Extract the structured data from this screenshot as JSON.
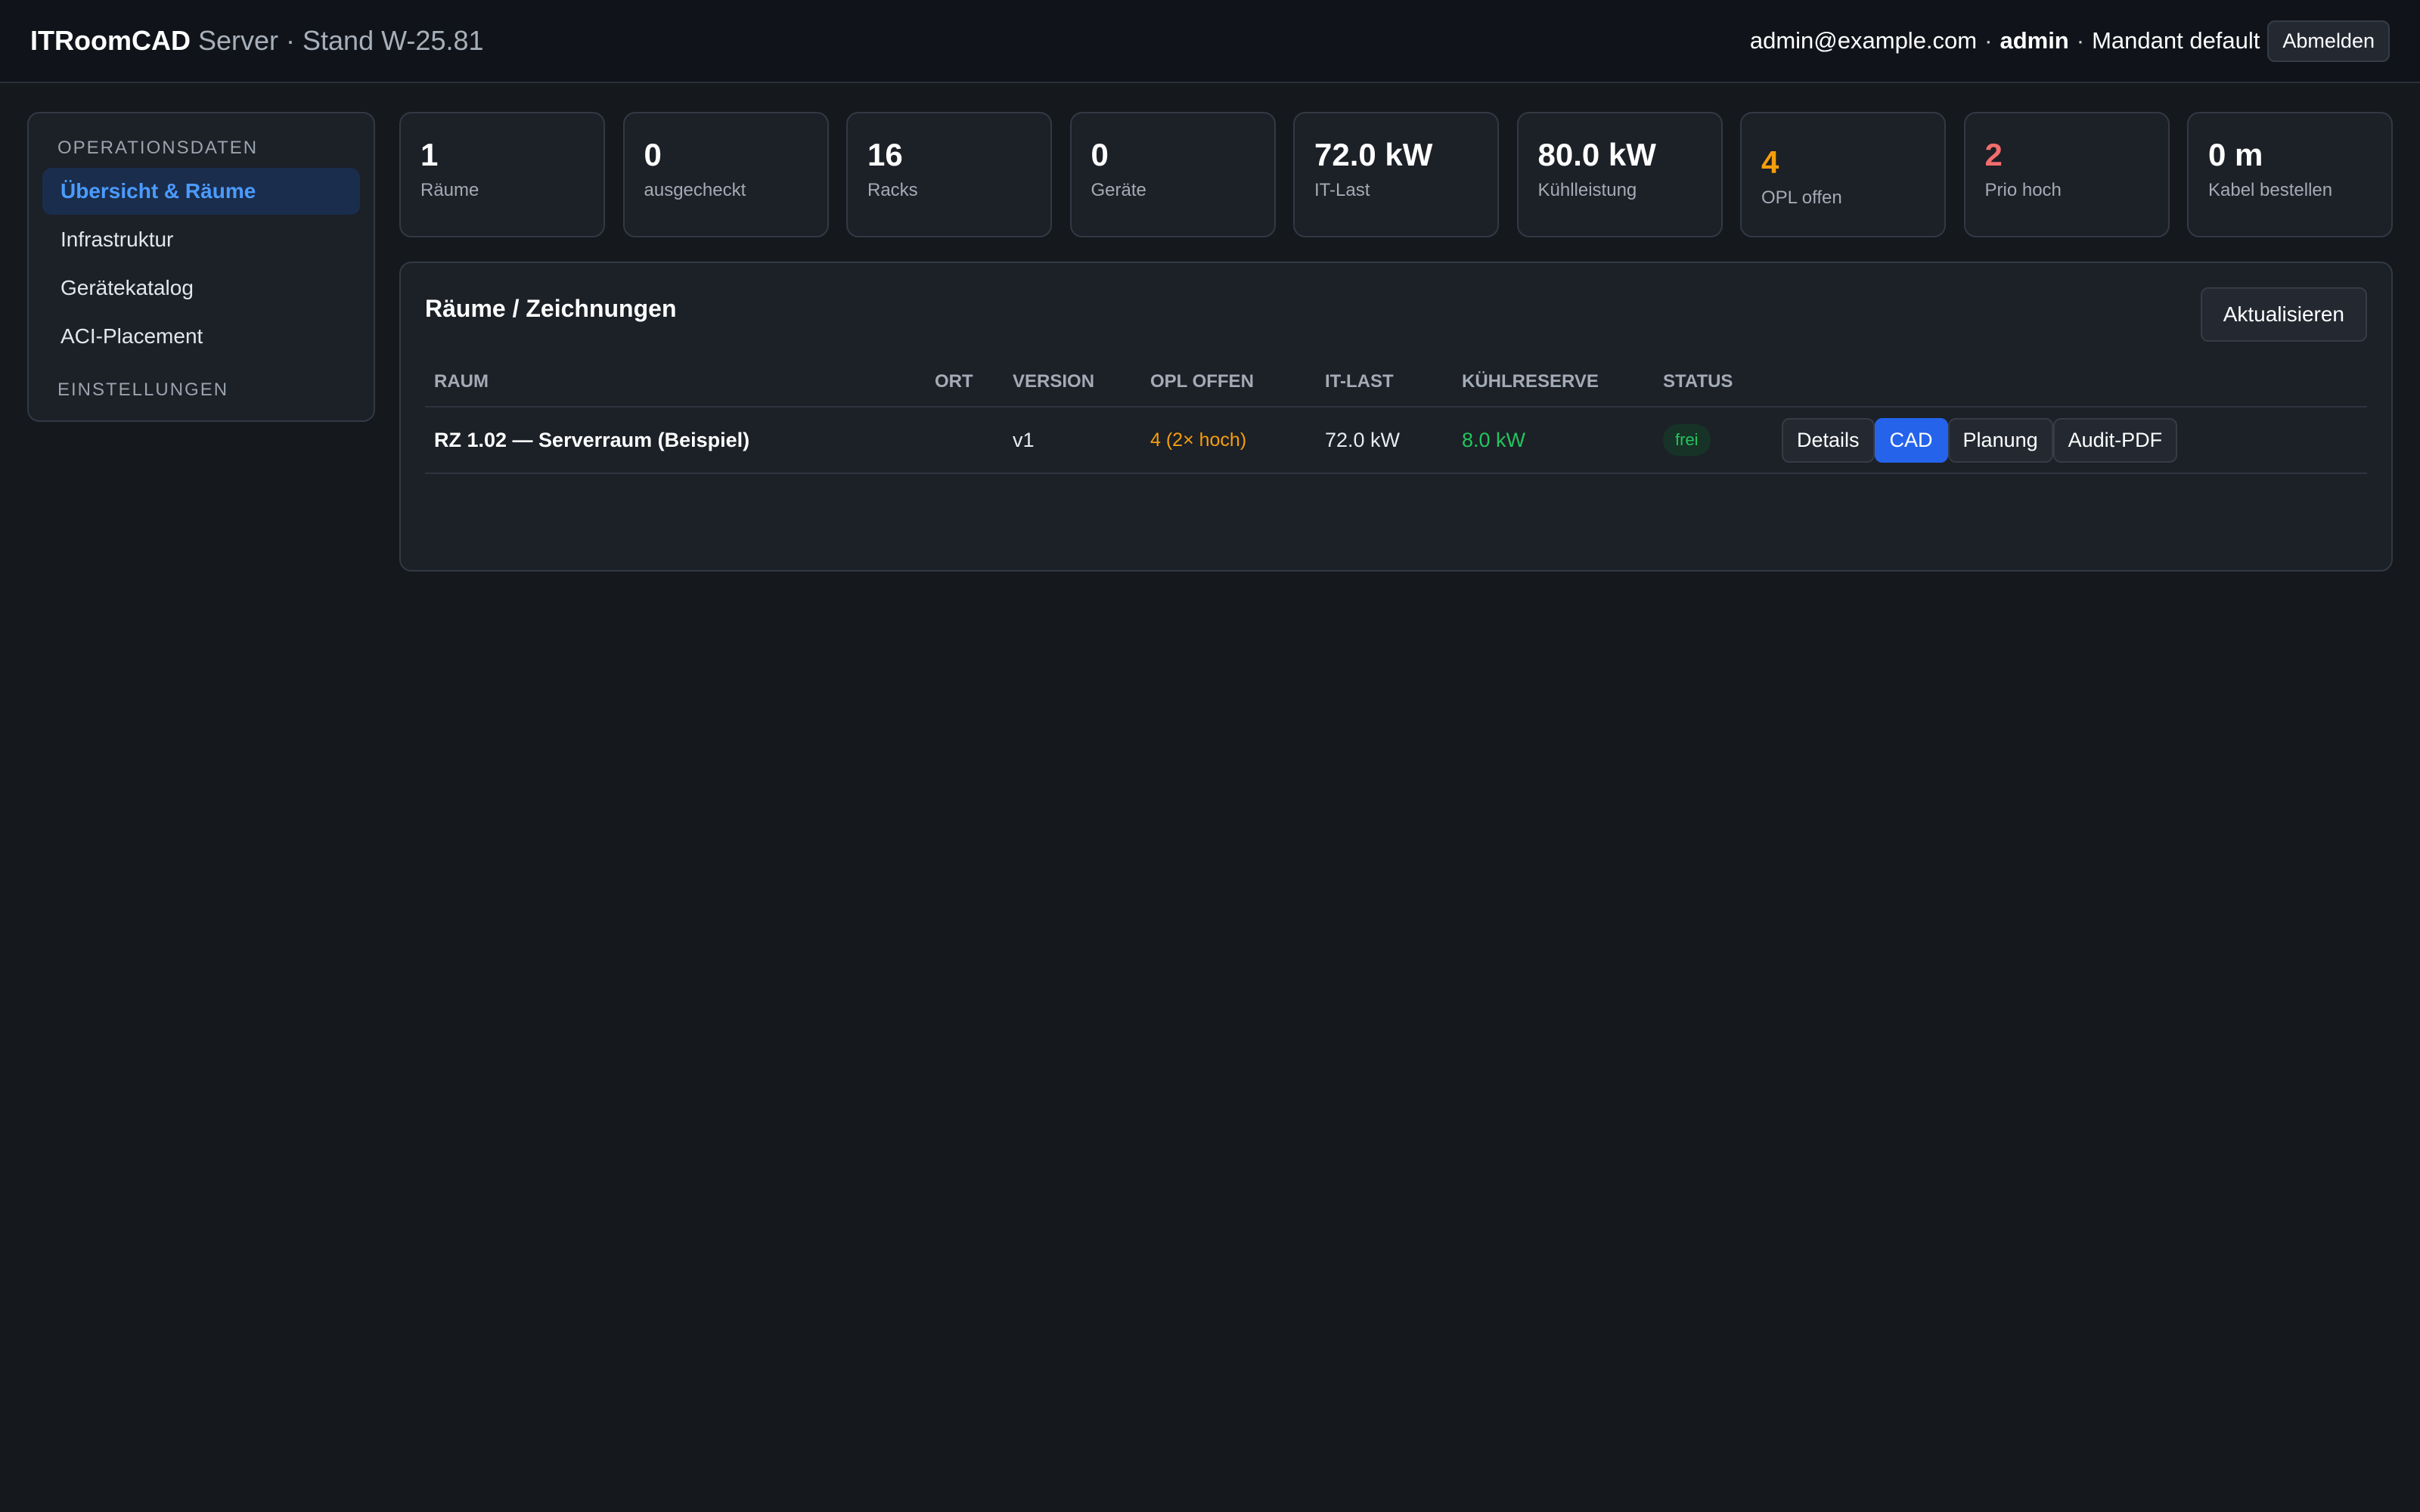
{
  "header": {
    "app_name": "ITRoomCAD",
    "subtitle": "Server · Stand W-25.81",
    "user_email": "admin@example.com",
    "separator": "·",
    "user_role": "admin",
    "tenant": "Mandant default",
    "logout_label": "Abmelden"
  },
  "sidebar": {
    "section1": "OPERATIONSDATEN",
    "items": [
      {
        "label": "Übersicht & Räume",
        "active": true
      },
      {
        "label": "Infrastruktur"
      },
      {
        "label": "Gerätekatalog"
      },
      {
        "label": "ACI-Placement"
      }
    ],
    "section2": "EINSTELLUNGEN"
  },
  "kpis": [
    {
      "value": "1",
      "label": "Räume"
    },
    {
      "value": "0",
      "label": "ausgecheckt"
    },
    {
      "value": "16",
      "label": "Racks"
    },
    {
      "value": "0",
      "label": "Geräte"
    },
    {
      "value": "72.0 kW",
      "label": "IT-Last"
    },
    {
      "value": "80.0 kW",
      "label": "Kühlleistung"
    },
    {
      "value": "4",
      "label": "OPL offen",
      "color": "#f59e0b"
    },
    {
      "value": "2",
      "label": "Prio hoch",
      "color": "#f26d6d"
    },
    {
      "value": "0 m",
      "label": "Kabel bestellen"
    }
  ],
  "rooms": {
    "title": "Räume / Zeichnungen",
    "refresh_label": "Aktualisieren",
    "columns": [
      "Raum",
      "Ort",
      "Version",
      "OPL offen",
      "IT-Last",
      "Kühlreserve",
      "Status"
    ],
    "rows": [
      {
        "raum": "RZ 1.02 — Serverraum (Beispiel)",
        "ort": "",
        "version": "v1",
        "opl": "4 (2× hoch)",
        "it_last": "72.0 kW",
        "reserve": "8.0 kW",
        "status": "frei",
        "actions": [
          "Details",
          "CAD",
          "Planung",
          "Audit-PDF"
        ]
      }
    ]
  },
  "colors": {
    "accent": "#2563eb",
    "warning": "#f59e0b",
    "danger": "#f26d6d",
    "success": "#22c55e"
  }
}
